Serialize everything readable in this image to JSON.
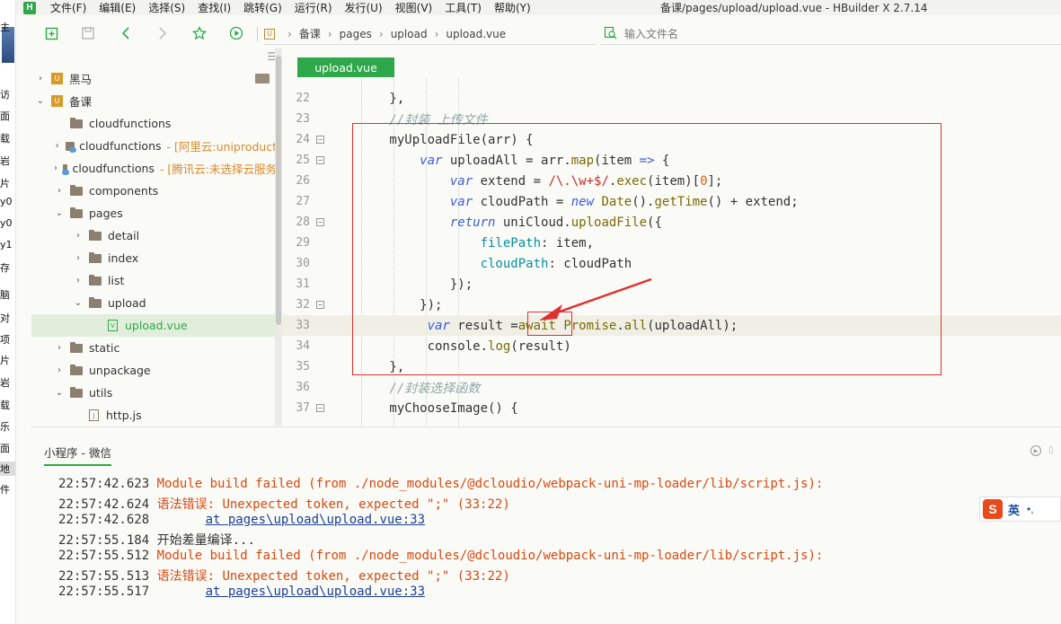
{
  "window": {
    "title": "备课/pages/upload/upload.vue - HBuilder X 2.7.14"
  },
  "left_strip": {
    "items": [
      "主",
      "访",
      "面",
      "载",
      "岩",
      "片",
      "y0",
      "y0",
      "y1",
      "存",
      "脑",
      "对",
      "项",
      "片",
      "岩",
      "载",
      "乐",
      "面",
      "地",
      "件"
    ],
    "selected_index": 18
  },
  "menu": {
    "logo": "H",
    "items": [
      "文件(F)",
      "编辑(E)",
      "选择(S)",
      "查找(I)",
      "跳转(G)",
      "运行(R)",
      "发行(U)",
      "视图(V)",
      "工具(T)",
      "帮助(Y)"
    ]
  },
  "toolbar": {
    "breadcrumb": [
      "备课",
      "pages",
      "upload",
      "upload.vue"
    ],
    "file_search_placeholder": "输入文件名"
  },
  "sidebar": {
    "rows": [
      {
        "label": "黑马",
        "hint": "",
        "type": "project",
        "expanded": false
      },
      {
        "label": "备课",
        "hint": "",
        "type": "project",
        "expanded": true
      },
      {
        "label": "cloudfunctions",
        "hint": "",
        "type": "folder",
        "expanded": null
      },
      {
        "label": "cloudfunctions",
        "hint": "- [阿里云:uniproduct",
        "type": "cloud",
        "expanded": false
      },
      {
        "label": "cloudfunctions",
        "hint": "- [腾讯云:未选择云服务",
        "type": "cloud",
        "expanded": false
      },
      {
        "label": "components",
        "hint": "",
        "type": "folder",
        "expanded": false
      },
      {
        "label": "pages",
        "hint": "",
        "type": "folder",
        "expanded": true
      },
      {
        "label": "detail",
        "hint": "",
        "type": "folder",
        "expanded": false
      },
      {
        "label": "index",
        "hint": "",
        "type": "folder",
        "expanded": false
      },
      {
        "label": "list",
        "hint": "",
        "type": "folder",
        "expanded": false
      },
      {
        "label": "upload",
        "hint": "",
        "type": "folder",
        "expanded": true
      },
      {
        "label": "upload.vue",
        "hint": "",
        "type": "vue",
        "expanded": null
      },
      {
        "label": "static",
        "hint": "",
        "type": "folder",
        "expanded": false
      },
      {
        "label": "unpackage",
        "hint": "",
        "type": "folder",
        "expanded": false
      },
      {
        "label": "utils",
        "hint": "",
        "type": "folder",
        "expanded": true
      },
      {
        "label": "http.js",
        "hint": "",
        "type": "file",
        "expanded": null
      }
    ]
  },
  "editor": {
    "active_tab": "upload.vue",
    "lines": [
      {
        "n": "22",
        "text": "        },"
      },
      {
        "n": "23",
        "text": "        //封装 上传文件"
      },
      {
        "n": "24",
        "text": "        myUploadFile(arr) {"
      },
      {
        "n": "25",
        "text": "            var uploadAll = arr.map(item => {"
      },
      {
        "n": "26",
        "text": "                var extend = /\\.\\w+$/.exec(item)[0];"
      },
      {
        "n": "27",
        "text": "                var cloudPath = new Date().getTime() + extend;"
      },
      {
        "n": "28",
        "text": "                return uniCloud.uploadFile({"
      },
      {
        "n": "29",
        "text": "                    filePath: item,"
      },
      {
        "n": "30",
        "text": "                    cloudPath: cloudPath"
      },
      {
        "n": "31",
        "text": "                });"
      },
      {
        "n": "32",
        "text": "            });"
      },
      {
        "n": "33",
        "text": "             var result =await Promise.all(uploadAll);"
      },
      {
        "n": "34",
        "text": "             console.log(result)"
      },
      {
        "n": "35",
        "text": "        },"
      },
      {
        "n": "36",
        "text": "        //封装选择函数"
      },
      {
        "n": "37",
        "text": "        myChooseImage() {"
      }
    ]
  },
  "console": {
    "tab": "小程序 - 微信",
    "lines": [
      {
        "ts": "22:57:42.623",
        "text": "Module build failed (from ./node_modules/@dcloudio/webpack-uni-mp-loader/lib/script.js):",
        "kind": "err"
      },
      {
        "ts": "22:57:42.624",
        "text": "语法错误: Unexpected token, expected \";\" (33:22)",
        "kind": "err"
      },
      {
        "ts": "22:57:42.628",
        "text": "at pages\\upload\\upload.vue:33",
        "kind": "link"
      },
      {
        "ts": "22:57:55.184",
        "text": "开始差量编译...",
        "kind": "info"
      },
      {
        "ts": "22:57:55.512",
        "text": "Module build failed (from ./node_modules/@dcloudio/webpack-uni-mp-loader/lib/script.js):",
        "kind": "err"
      },
      {
        "ts": "22:57:55.513",
        "text": "语法错误: Unexpected token, expected \";\" (33:22)",
        "kind": "err"
      },
      {
        "ts": "22:57:55.517",
        "text": "at pages\\upload\\upload.vue:33",
        "kind": "link"
      }
    ]
  },
  "ime": {
    "logo": "S",
    "mode": "英",
    "extra": "•,"
  },
  "colors": {
    "accent": "#2ea84a",
    "annotation": "#e03131",
    "error": "#d9480f"
  }
}
